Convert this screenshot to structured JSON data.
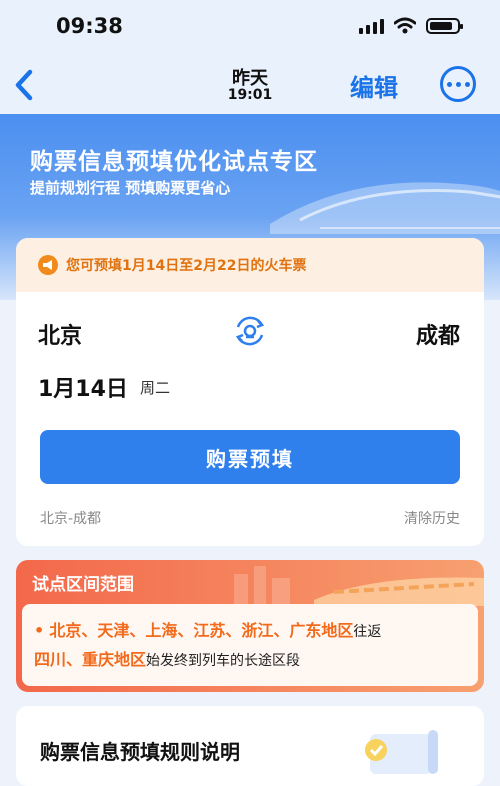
{
  "status_bar": {
    "time": "09:38"
  },
  "nav": {
    "title": "昨天",
    "subtitle": "19:01",
    "edit_label": "编辑"
  },
  "banner": {
    "title": "购票信息预填优化试点专区",
    "subtitle": "提前规划行程 预填购票更省心"
  },
  "notice": {
    "text": "您可预填1月14日至2月22日的火车票"
  },
  "trip": {
    "from": "北京",
    "to": "成都",
    "date": "1月14日",
    "weekday": "周二"
  },
  "buttons": {
    "prefill": "购票预填",
    "clear_history": "清除历史"
  },
  "history": {
    "route": "北京-成都"
  },
  "range": {
    "title": "试点区间范围",
    "bullet": "•",
    "line1_highlight": "北京、天津、上海、江苏、浙江、广东地区",
    "line1_plain": "往返",
    "line2_highlight": "四川、重庆地区",
    "line2_plain": "始发终到列车的长途区段"
  },
  "rules": {
    "title": "购票信息预填规则说明"
  },
  "colors": {
    "accent": "#2f80ed",
    "notice_text": "#e07310",
    "range_header": "#f3684a"
  }
}
